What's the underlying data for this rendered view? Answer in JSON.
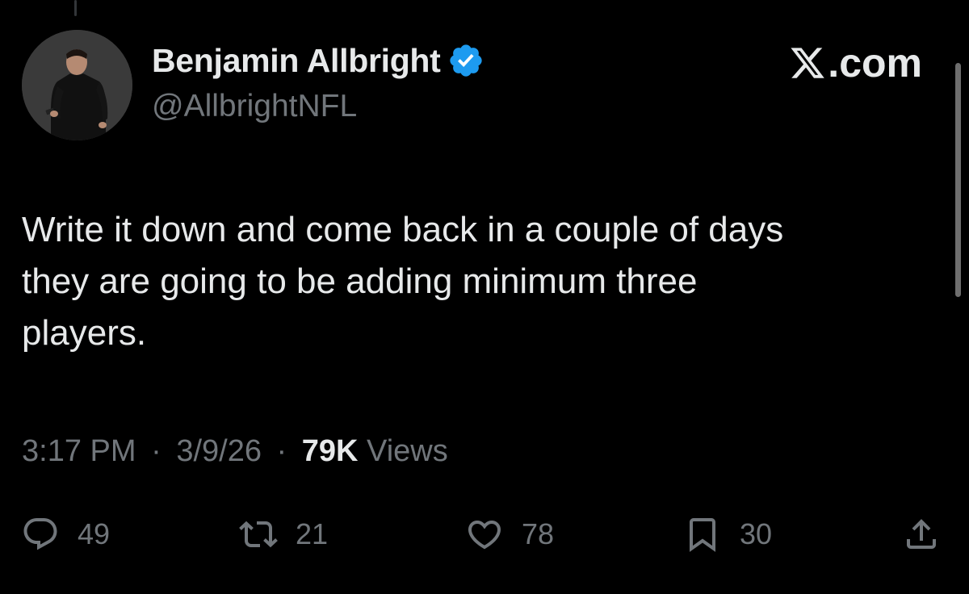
{
  "author": {
    "name": "Benjamin Allbright",
    "handle": "@AllbrightNFL",
    "verified_icon": "verified-badge-icon",
    "verified_color": "#1d9bf0"
  },
  "brand": {
    "label": ".com",
    "logo_icon": "x-logo-icon"
  },
  "tweet": {
    "text": "Write it down and come back in a couple of days\nthey are going to be adding minimum three\nplayers."
  },
  "meta": {
    "time": "3:17 PM",
    "separator": "·",
    "date": "3/9/26",
    "views_count": "79K",
    "views_label": "Views"
  },
  "actions": {
    "replies": "49",
    "reposts": "21",
    "likes": "78",
    "bookmarks": "30"
  },
  "colors": {
    "background": "#000000",
    "primary_text": "#e7e9ea",
    "secondary_text": "#71767b",
    "accent": "#1d9bf0"
  }
}
